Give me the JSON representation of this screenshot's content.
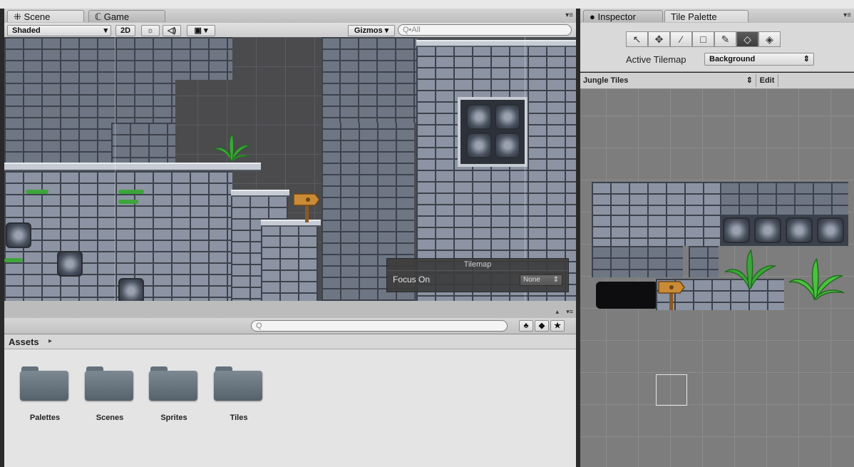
{
  "scene_panel": {
    "tabs": [
      {
        "label": "Scene",
        "icon": "scene-icon"
      },
      {
        "label": "Game",
        "icon": "game-icon"
      }
    ],
    "toolbar": {
      "shading_mode": "Shaded",
      "mode_2d": "2D",
      "gizmos": "Gizmos",
      "search_placeholder": "Q•All"
    },
    "overlay": {
      "title": "Tilemap",
      "focus_label": "Focus On",
      "focus_value": "None"
    }
  },
  "project_panel": {
    "search_placeholder": "Q",
    "breadcrumb": "Assets",
    "folders": [
      {
        "label": "Palettes"
      },
      {
        "label": "Scenes"
      },
      {
        "label": "Sprites"
      },
      {
        "label": "Tiles"
      }
    ]
  },
  "right_panel": {
    "tabs": [
      {
        "label": "Inspector",
        "icon": "info-icon"
      },
      {
        "label": "Tile Palette"
      }
    ],
    "tools": [
      "select-tool",
      "move-tool",
      "paint-brush-tool",
      "box-fill-tool",
      "eyedropper-tool",
      "eraser-tool",
      "flood-fill-tool"
    ],
    "selected_tool_index": 5,
    "active_tilemap_label": "Active Tilemap",
    "active_tilemap_value": "Background",
    "palette_name": "Jungle Tiles",
    "edit_label": "Edit"
  },
  "colors": {
    "stone": "#6e7684",
    "grid_bg": "#7d7d7d",
    "foliage": "#3da53a",
    "selection": "#3e3e3e"
  }
}
